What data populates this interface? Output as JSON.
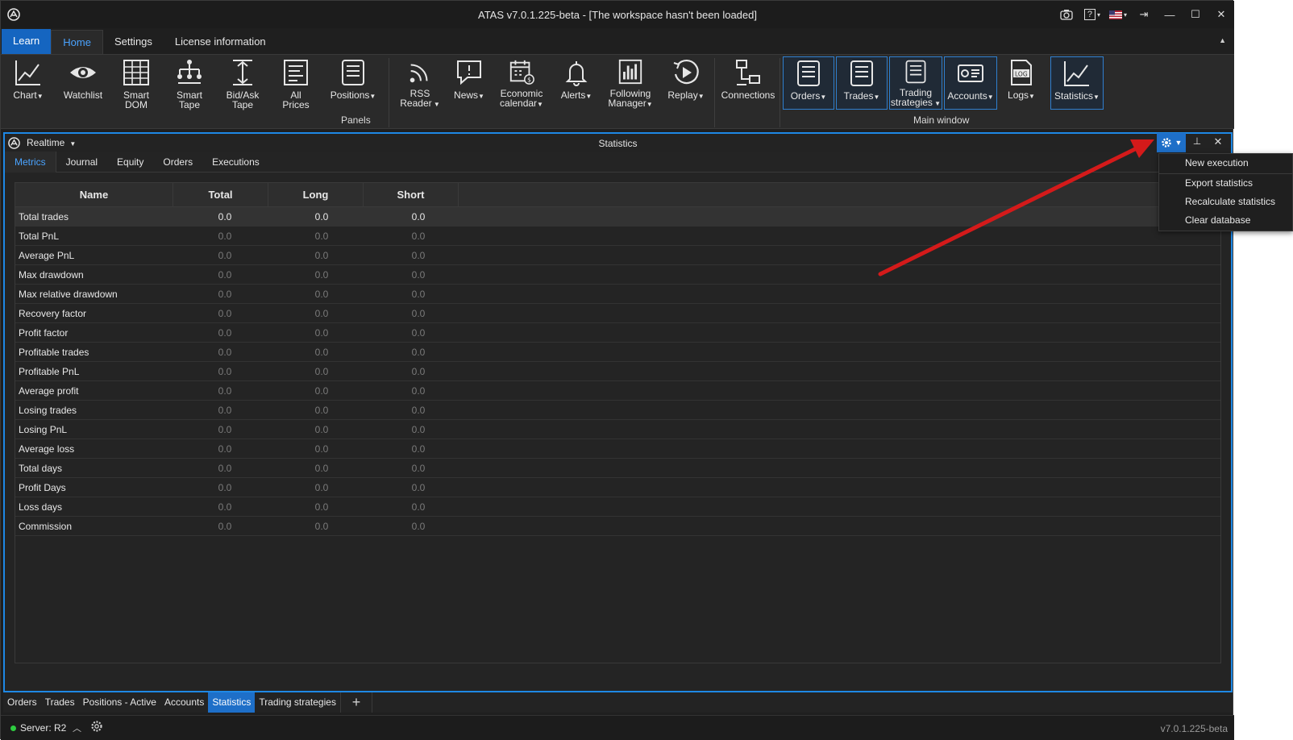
{
  "window": {
    "title": "ATAS v7.0.1.225-beta - [The workspace hasn't been loaded]",
    "help_label": "?",
    "lang_label": "▾"
  },
  "ribbon_tabs": [
    "Learn",
    "Home",
    "Settings",
    "License information"
  ],
  "ribbon_buttons": {
    "chart": "Chart",
    "watchlist": "Watchlist",
    "smart_dom": "Smart\nDOM",
    "smart_tape": "Smart\nTape",
    "bidask_tape": "Bid/Ask\nTape",
    "all_prices": "All\nPrices",
    "positions": "Positions",
    "rss_reader": "RSS\nReader",
    "news": "News",
    "economic_calendar": "Economic\ncalendar",
    "alerts": "Alerts",
    "following_manager": "Following\nManager",
    "replay": "Replay",
    "connections": "Connections",
    "orders": "Orders",
    "trades": "Trades",
    "trading_strategies": "Trading\nstrategies",
    "accounts": "Accounts",
    "logs": "Logs",
    "statistics": "Statistics"
  },
  "ribbon_groups": {
    "panels": "Panels",
    "main_window": "Main window"
  },
  "panel": {
    "mode": "Realtime",
    "title": "Statistics",
    "tabs": [
      "Metrics",
      "Journal",
      "Equity",
      "Orders",
      "Executions"
    ]
  },
  "table": {
    "columns": [
      "Name",
      "Total",
      "Long",
      "Short"
    ],
    "rows": [
      [
        "Total trades",
        "0.0",
        "0.0",
        "0.0"
      ],
      [
        "Total PnL",
        "0.0",
        "0.0",
        "0.0"
      ],
      [
        "Average PnL",
        "0.0",
        "0.0",
        "0.0"
      ],
      [
        "Max drawdown",
        "0.0",
        "0.0",
        "0.0"
      ],
      [
        "Max relative drawdown",
        "0.0",
        "0.0",
        "0.0"
      ],
      [
        "Recovery factor",
        "0.0",
        "0.0",
        "0.0"
      ],
      [
        "Profit factor",
        "0.0",
        "0.0",
        "0.0"
      ],
      [
        "Profitable trades",
        "0.0",
        "0.0",
        "0.0"
      ],
      [
        "Profitable PnL",
        "0.0",
        "0.0",
        "0.0"
      ],
      [
        "Average profit",
        "0.0",
        "0.0",
        "0.0"
      ],
      [
        "Losing trades",
        "0.0",
        "0.0",
        "0.0"
      ],
      [
        "Losing PnL",
        "0.0",
        "0.0",
        "0.0"
      ],
      [
        "Average loss",
        "0.0",
        "0.0",
        "0.0"
      ],
      [
        "Total days",
        "0.0",
        "0.0",
        "0.0"
      ],
      [
        "Profit Days",
        "0.0",
        "0.0",
        "0.0"
      ],
      [
        "Loss days",
        "0.0",
        "0.0",
        "0.0"
      ],
      [
        "Commission",
        "0.0",
        "0.0",
        "0.0"
      ]
    ]
  },
  "settings_menu": [
    "New execution",
    "Export statistics",
    "Recalculate statistics",
    "Clear database"
  ],
  "bottom_tabs": [
    "Orders",
    "Trades",
    "Positions - Active",
    "Accounts",
    "Statistics",
    "Trading strategies"
  ],
  "bottom_add_label": "+",
  "status": {
    "server": "Server: R2",
    "version": "v7.0.1.225-beta"
  },
  "colors": {
    "accent": "#1e88e5",
    "annotation_arrow": "#d41a1a",
    "server_online": "#2ecc40"
  }
}
